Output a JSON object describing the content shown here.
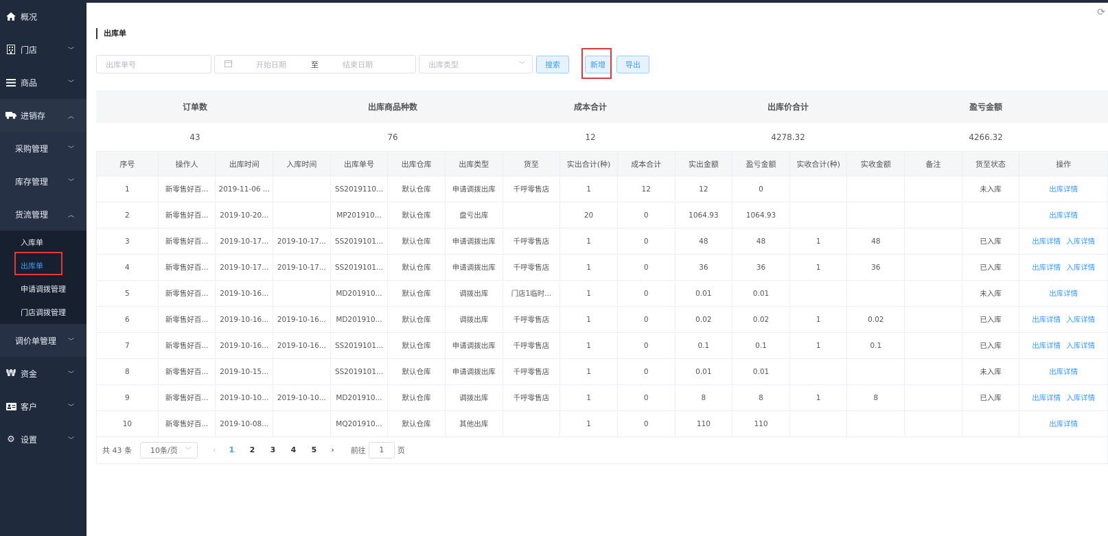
{
  "sidebar": {
    "items": [
      {
        "icon": "home-icon",
        "glyph": "🏠",
        "label": "概况"
      },
      {
        "icon": "store-icon",
        "glyph": "▦",
        "label": "门店"
      },
      {
        "icon": "list-icon",
        "glyph": "≡",
        "label": "商品"
      },
      {
        "icon": "truck-icon",
        "glyph": "🚚",
        "label": "进销存"
      }
    ],
    "sub_items": [
      "采购管理",
      "库存管理",
      "货流管理"
    ],
    "leaf_items": [
      "入库单",
      "出库单",
      "申请调拨管理",
      "门店调拨管理"
    ],
    "after_items": [
      "调价单管理"
    ],
    "bottom_items": [
      {
        "icon": "currency-icon",
        "glyph": "₩",
        "label": "资金"
      },
      {
        "icon": "customer-card-icon",
        "glyph": "▤",
        "label": "客户"
      },
      {
        "icon": "gear-icon",
        "glyph": "⚙",
        "label": "设置"
      }
    ]
  },
  "page": {
    "title": "出库单"
  },
  "filters": {
    "order_no_placeholder": "出库单号",
    "start_date_placeholder": "开始日期",
    "date_separator": "至",
    "end_date_placeholder": "结束日期",
    "type_placeholder": "出库类型"
  },
  "toolbar": {
    "search_label": "搜索",
    "add_label": "新增",
    "export_label": "导出"
  },
  "summary": {
    "headers": [
      "订单数",
      "出库商品种数",
      "成本合计",
      "出库价合计",
      "盈亏金额"
    ],
    "values": [
      "43",
      "76",
      "12",
      "4278.32",
      "4266.32"
    ]
  },
  "table": {
    "headers": [
      "序号",
      "操作人",
      "出库时间",
      "入库时间",
      "出库单号",
      "出库仓库",
      "出库类型",
      "货至",
      "实出合计(种)",
      "成本合计",
      "实出金额",
      "盈亏金额",
      "实收合计(种)",
      "实收金额",
      "备注",
      "货至状态",
      "操作"
    ],
    "rows": [
      [
        "1",
        "新零售好百...",
        "2019-11-06 ...",
        "",
        "SS2019110...",
        "默认仓库",
        "申请调拨出库",
        "千呼零售店",
        "1",
        "12",
        "12",
        "0",
        "",
        "",
        "",
        "未入库"
      ],
      [
        "2",
        "新零售好百...",
        "2019-10-20...",
        "",
        "MP201910...",
        "默认仓库",
        "盘亏出库",
        "",
        "20",
        "0",
        "1064.93",
        "1064.93",
        "",
        "",
        "",
        ""
      ],
      [
        "3",
        "新零售好百...",
        "2019-10-17...",
        "2019-10-17...",
        "SS2019101...",
        "默认仓库",
        "申请调拨出库",
        "千呼零售店",
        "1",
        "0",
        "48",
        "48",
        "1",
        "48",
        "",
        "已入库"
      ],
      [
        "4",
        "新零售好百...",
        "2019-10-17...",
        "2019-10-17...",
        "SS2019101...",
        "默认仓库",
        "申请调拨出库",
        "千呼零售店",
        "1",
        "0",
        "36",
        "36",
        "1",
        "36",
        "",
        "已入库"
      ],
      [
        "5",
        "新零售好百...",
        "2019-10-16...",
        "",
        "MD201910...",
        "默认仓库",
        "调拨出库",
        "门店1临时...",
        "1",
        "0",
        "0.01",
        "0.01",
        "",
        "",
        "",
        "未入库"
      ],
      [
        "6",
        "新零售好百...",
        "2019-10-16...",
        "2019-10-16...",
        "MD201910...",
        "默认仓库",
        "调拨出库",
        "千呼零售店",
        "1",
        "0",
        "0.02",
        "0.02",
        "1",
        "0.02",
        "",
        "已入库"
      ],
      [
        "7",
        "新零售好百...",
        "2019-10-16...",
        "2019-10-16...",
        "SS2019101...",
        "默认仓库",
        "申请调拨出库",
        "千呼零售店",
        "1",
        "0",
        "0.1",
        "0.1",
        "1",
        "0.1",
        "",
        "已入库"
      ],
      [
        "8",
        "新零售好百...",
        "2019-10-15...",
        "",
        "SS2019101...",
        "默认仓库",
        "申请调拨出库",
        "千呼零售店",
        "1",
        "0",
        "0.01",
        "0.01",
        "",
        "",
        "",
        "未入库"
      ],
      [
        "9",
        "新零售好百...",
        "2019-10-10...",
        "2019-10-10...",
        "MD201910...",
        "默认仓库",
        "调拨出库",
        "千呼零售店",
        "1",
        "0",
        "8",
        "8",
        "1",
        "8",
        "",
        "已入库"
      ],
      [
        "10",
        "新零售好百...",
        "2019-10-08...",
        "",
        "MQ201910...",
        "默认仓库",
        "其他出库",
        "",
        "1",
        "0",
        "110",
        "110",
        "",
        "",
        "",
        ""
      ]
    ],
    "row_actions": [
      [
        "出库详情"
      ],
      [
        "出库详情"
      ],
      [
        "出库详情",
        "入库详情"
      ],
      [
        "出库详情",
        "入库详情"
      ],
      [
        "出库详情"
      ],
      [
        "出库详情",
        "入库详情"
      ],
      [
        "出库详情",
        "入库详情"
      ],
      [
        "出库详情"
      ],
      [
        "出库详情",
        "入库详情"
      ],
      [
        "出库详情"
      ]
    ]
  },
  "pagination": {
    "total_text": "共 43 条",
    "page_size": "10条/页",
    "pages": [
      "1",
      "2",
      "3",
      "4",
      "5"
    ],
    "current_page": "1",
    "goto_label": "前往",
    "goto_value": "1",
    "goto_unit": "页"
  },
  "colors": {
    "sidebar_bg": "#1f2a3c",
    "accent": "#3d9bff",
    "highlight": "#e0383b"
  }
}
